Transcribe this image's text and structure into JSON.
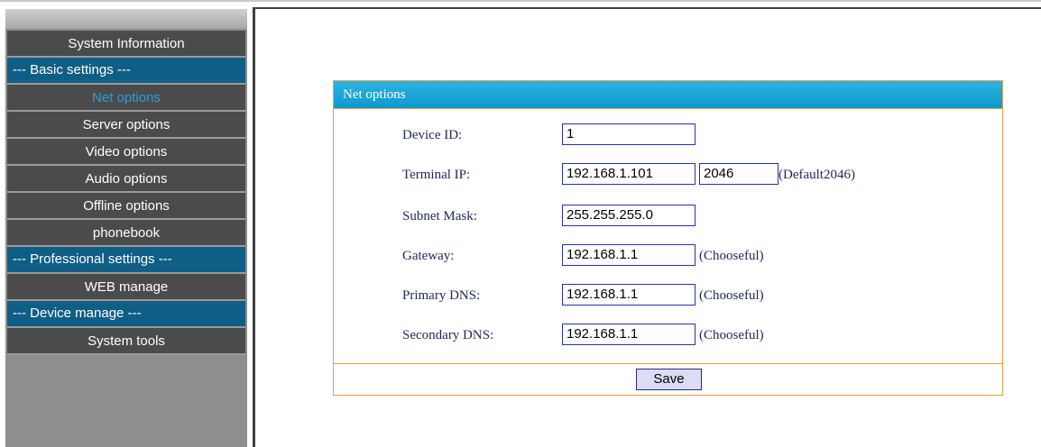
{
  "sidebar": {
    "items": [
      {
        "label": "System Information",
        "kind": "item"
      },
      {
        "label": "--- Basic settings ---",
        "kind": "header"
      },
      {
        "label": "Net options",
        "kind": "item",
        "active": true
      },
      {
        "label": "Server options",
        "kind": "item"
      },
      {
        "label": "Video options",
        "kind": "item"
      },
      {
        "label": "Audio options",
        "kind": "item"
      },
      {
        "label": "Offline options",
        "kind": "item"
      },
      {
        "label": "phonebook",
        "kind": "item"
      },
      {
        "label": "--- Professional settings ---",
        "kind": "header"
      },
      {
        "label": "WEB manage",
        "kind": "item"
      },
      {
        "label": "--- Device manage ---",
        "kind": "header"
      },
      {
        "label": "System tools",
        "kind": "item"
      }
    ]
  },
  "panel": {
    "title": "Net options",
    "fields": {
      "device_id": {
        "label": "Device ID:",
        "value": "1"
      },
      "terminal_ip": {
        "label": "Terminal IP:",
        "value": "192.168.1.101",
        "port": "2046",
        "hint": "(Default2046)"
      },
      "subnet_mask": {
        "label": "Subnet Mask:",
        "value": "255.255.255.0"
      },
      "gateway": {
        "label": "Gateway:",
        "value": "192.168.1.1",
        "hint": "(Chooseful)"
      },
      "primary_dns": {
        "label": "Primary DNS:",
        "value": "192.168.1.1",
        "hint": "(Chooseful)"
      },
      "secondary_dns": {
        "label": "Secondary DNS:",
        "value": "192.168.1.1",
        "hint": "(Chooseful)"
      }
    },
    "save_label": "Save"
  },
  "colors": {
    "menu_item_bg": "#4b4b4b",
    "menu_header_bg": "#0f5e85",
    "active_item_text": "#2f9be0",
    "panel_header": "#1aa5d8",
    "panel_border": "#f0a040"
  }
}
